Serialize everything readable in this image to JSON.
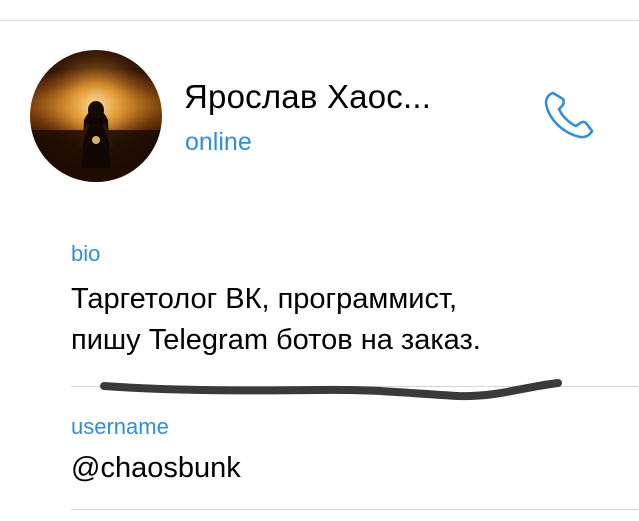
{
  "profile": {
    "name": "Ярослав Хаос...",
    "status": "online",
    "avatar": "profile-photo-icon",
    "call_icon": "phone-icon"
  },
  "bio": {
    "label": "bio",
    "lines": [
      "Таргетолог ВК, программист,",
      "пишу Telegram ботов на заказ."
    ]
  },
  "username": {
    "label": "username",
    "value": "@chaosbunk"
  },
  "colors": {
    "accent": "#2f8ee0",
    "text": "#000000",
    "divider": "#d6d6d6",
    "scribble": "#3a3a3a"
  }
}
